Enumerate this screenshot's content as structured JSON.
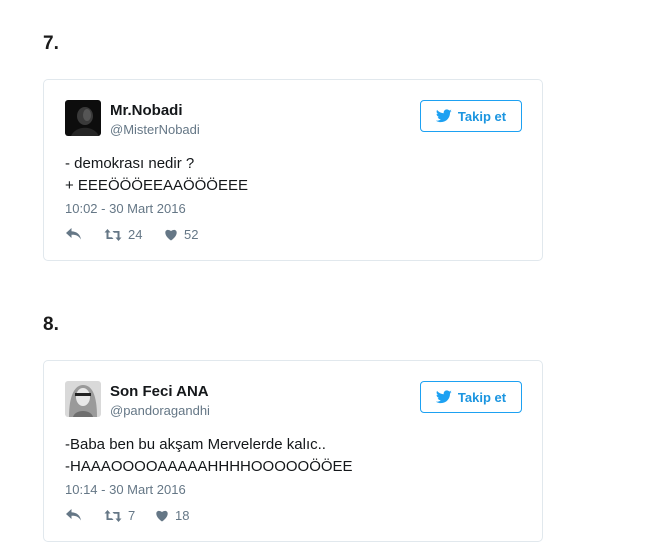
{
  "sections": [
    {
      "number": "7.",
      "tweet": {
        "display_name": "Mr.Nobadi",
        "handle": "@MisterNobadi",
        "follow_label": "Takip et",
        "text": "- demokrası nedir ?\n+ EEEÖÖÖEEAAÖÖÖEEE",
        "timestamp": "10:02 - 30 Mart 2016",
        "retweets": "24",
        "likes": "52"
      }
    },
    {
      "number": "8.",
      "tweet": {
        "display_name": "Son Feci ANA",
        "handle": "@pandoragandhi",
        "follow_label": "Takip et",
        "text": "-Baba ben bu akşam Mervelerde kalıc..\n-HAAAOOOOAAAAAHHHHOOOOOÖÖEE",
        "timestamp": "10:14 - 30 Mart 2016",
        "retweets": "7",
        "likes": "18"
      }
    }
  ],
  "colors": {
    "twitter_blue": "#1da1f2",
    "muted": "#657786",
    "border": "#e1e8ed"
  }
}
